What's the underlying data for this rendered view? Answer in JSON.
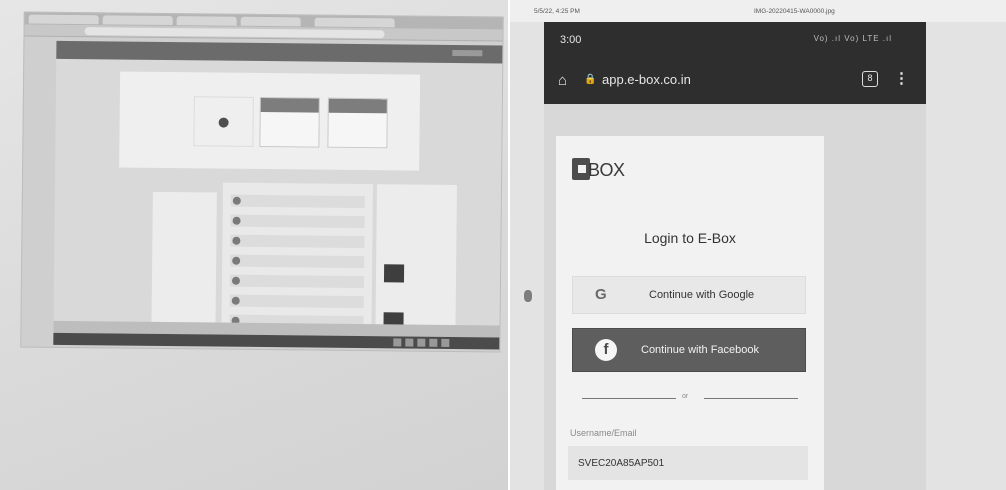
{
  "left_photo": {
    "description_free": true
  },
  "print_header": {
    "datetime": "5/5/22, 4:25 PM",
    "filename": "IMG-20220415-WA0000.jpg"
  },
  "phone": {
    "status_time": "3:00",
    "status_icons": "Vo) .ıl Vo) LTE .ıl",
    "url": "app.e-box.co.in",
    "tabs_count": "8"
  },
  "login": {
    "logo_text": "BOX",
    "title": "Login to E-Box",
    "google_label": "Continue with Google",
    "facebook_label": "Continue with Facebook",
    "or_text": "or",
    "username_label": "Username/Email",
    "username_value": "SVEC20A85AP501"
  },
  "icons": {
    "home": "home-icon",
    "lock": "lock-icon",
    "menu": "kebab-menu-icon",
    "google": "google-icon",
    "facebook": "facebook-icon"
  }
}
